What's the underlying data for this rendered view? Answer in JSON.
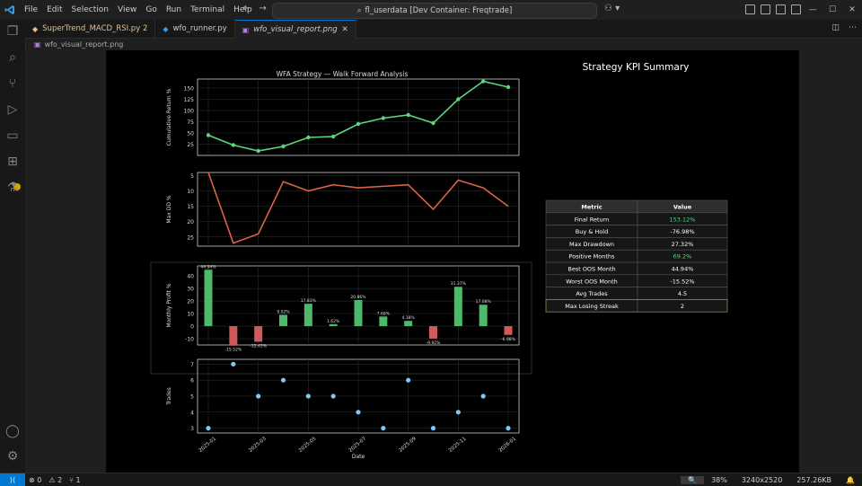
{
  "menu": [
    "File",
    "Edit",
    "Selection",
    "View",
    "Go",
    "Run",
    "Terminal",
    "Help"
  ],
  "command_center": "fl_userdata [Dev Container: Freqtrade]",
  "tabs": [
    {
      "label": "SuperTrend_MACD_RSI.py 2",
      "color": "#e2c08d",
      "icon": "python-icon"
    },
    {
      "label": "wfo_runner.py",
      "color": "#cccccc",
      "icon": "python-icon"
    },
    {
      "label": "wfo_visual_report.png",
      "color": "#cccccc",
      "icon": "image-icon"
    }
  ],
  "breadcrumb": "wfo_visual_report.png",
  "image": {
    "chart_title": "WFA Strategy — Walk Forward Analysis",
    "kpi_title": "Strategy KPI Summary",
    "kpi_header": [
      "Metric",
      "Value"
    ],
    "kpi_rows": [
      {
        "metric": "Final Return",
        "value": "153.12%",
        "color": "#5cd67c"
      },
      {
        "metric": "Buy & Hold",
        "value": "-76.98%",
        "color": "#ffffff"
      },
      {
        "metric": "Max Drawdown",
        "value": "27.32%",
        "color": "#ffffff"
      },
      {
        "metric": "Positive Months",
        "value": "69.2%",
        "color": "#5cd67c"
      },
      {
        "metric": "Best OOS Month",
        "value": "44.94%",
        "color": "#ffffff"
      },
      {
        "metric": "Worst OOS Month",
        "value": "-15.52%",
        "color": "#ffffff"
      },
      {
        "metric": "Avg Trades",
        "value": "4.5",
        "color": "#ffffff"
      },
      {
        "metric": "Max Losing Streak",
        "value": "2",
        "color": "#ffffff"
      }
    ]
  },
  "chart_data": [
    {
      "type": "line",
      "title": "WFA Strategy — Walk Forward Analysis",
      "ylabel": "Cumulative Return %",
      "ylim": [
        0,
        170
      ],
      "yticks": [
        25,
        50,
        75,
        100,
        125,
        150
      ],
      "x": [
        0,
        1,
        2,
        3,
        4,
        5,
        6,
        7,
        8,
        9,
        10,
        11,
        12
      ],
      "values": [
        45,
        23,
        10,
        20,
        40,
        42,
        70,
        83,
        90,
        72,
        125,
        165,
        152
      ],
      "color": "#5cd67c",
      "grid": true
    },
    {
      "type": "line",
      "ylabel": "Max DD %",
      "ylim": [
        28,
        4
      ],
      "yticks": [
        5,
        10,
        15,
        20,
        25
      ],
      "x": [
        0,
        1,
        2,
        3,
        4,
        5,
        6,
        7,
        8,
        9,
        10,
        11,
        12
      ],
      "values": [
        4,
        27,
        24,
        7,
        10,
        8,
        9,
        8.5,
        8,
        16,
        6.5,
        9,
        15
      ],
      "color": "#d9634a",
      "grid": true
    },
    {
      "type": "bar",
      "ylabel": "Monthly Profit %",
      "ylim": [
        -15,
        48
      ],
      "yticks": [
        -10,
        0,
        10,
        20,
        30,
        40
      ],
      "x": [
        0,
        1,
        2,
        3,
        4,
        5,
        6,
        7,
        8,
        9,
        10,
        11,
        12
      ],
      "values": [
        44.94,
        -15.52,
        -12.45,
        9.02,
        17.83,
        1.62,
        20.86,
        7.68,
        4.18,
        -9.92,
        31.37,
        17.08,
        -6.98
      ],
      "labels": [
        "44.94%",
        "-15.52%",
        "-12.45%",
        "9.02%",
        "17.83%",
        "1.62%",
        "20.86%",
        "7.68%",
        "4.18%",
        "-9.92%",
        "31.37%",
        "17.08%",
        "-6.98%"
      ],
      "pos_color": "#4fb86a",
      "neg_color": "#d05a5a",
      "grid": true
    },
    {
      "type": "scatter",
      "ylabel": "Trades",
      "xlabel": "Date",
      "ylim": [
        2.7,
        7.3
      ],
      "yticks": [
        3,
        4,
        5,
        6,
        7
      ],
      "x": [
        0,
        1,
        2,
        3,
        4,
        5,
        6,
        7,
        8,
        9,
        10,
        11,
        12
      ],
      "values": [
        3,
        7,
        5,
        6,
        5,
        5,
        4,
        3,
        6,
        3,
        4,
        5,
        3
      ],
      "color": "#7fc8f8",
      "grid": true,
      "xtick_labels": [
        "2025-01",
        "2025-03",
        "2025-05",
        "2025-07",
        "2025-09",
        "2025-11",
        "2026-01"
      ]
    }
  ],
  "status": {
    "errors": "0",
    "warnings": "2",
    "ports": "1",
    "zoom": "38%",
    "dims": "3240x2520",
    "size": "257.26KB"
  }
}
